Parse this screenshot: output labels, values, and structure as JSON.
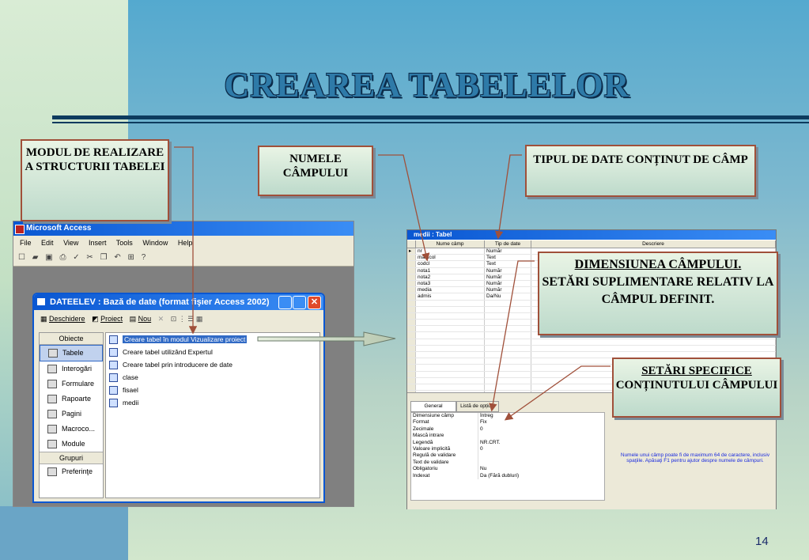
{
  "slide": {
    "title": "CREAREA TABELELOR",
    "page_number": "14"
  },
  "callouts": {
    "modul": "MODUL DE REALIZARE A STRUCTURII TABELEI",
    "numele": "NUMELE CÂMPULUI",
    "tipul": "TIPUL DE DATE CONȚINUT DE CÂMP",
    "dimensiunea_underlined": "DIMENSIUNEA CÂMPULUI.",
    "dimensiunea_rest": "SETĂRI SUPLIMENTARE RELATIV LA CÂMPUL DEFINIT.",
    "setari_underlined": "SETĂRI SPECIFICE",
    "setari_rest": "CONȚINUTULUI CÂMPULUI"
  },
  "access_window": {
    "title": "Microsoft Access",
    "menu": [
      "File",
      "Edit",
      "View",
      "Insert",
      "Tools",
      "Window",
      "Help"
    ],
    "db_window": {
      "title": "DATEELEV : Bază de date (format fişier Access 2002)",
      "toolbar": [
        "Deschidere",
        "Proiect",
        "Nou"
      ],
      "objects_header": "Obiecte",
      "objects": [
        "Tabele",
        "Interogări",
        "Formulare",
        "Rapoarte",
        "Pagini",
        "Macroco...",
        "Module"
      ],
      "groups_header": "Grupuri",
      "groups": [
        "Preferinţe"
      ],
      "items": [
        "Creare tabel în modul Vizualizare proiect",
        "Creare tabel utilizând Expertul",
        "Creare tabel prin introducere de date",
        "clase",
        "fisael",
        "medii"
      ]
    }
  },
  "table_design": {
    "title": "medii : Tabel",
    "headers": [
      "Nume câmp",
      "Tip de date",
      "Descriere"
    ],
    "rows": [
      [
        "nr",
        "Număr"
      ],
      [
        "matricol",
        "Text"
      ],
      [
        "codcl",
        "Text"
      ],
      [
        "nota1",
        "Număr"
      ],
      [
        "nota2",
        "Număr"
      ],
      [
        "nota3",
        "Număr"
      ],
      [
        "media",
        "Număr"
      ],
      [
        "admis",
        "Da/Nu"
      ]
    ],
    "tabs": [
      "General",
      "Listă de opțiuni"
    ],
    "properties": [
      [
        "Dimensiune câmp",
        "Întreg"
      ],
      [
        "Format",
        "Fix"
      ],
      [
        "Zecimale",
        "0"
      ],
      [
        "Mască intrare",
        ""
      ],
      [
        "Legendă",
        "NR.CRT."
      ],
      [
        "Valoare implicită",
        "0"
      ],
      [
        "Regulă de validare",
        ""
      ],
      [
        "Text de validare",
        ""
      ],
      [
        "Obligatoriu",
        "Nu"
      ],
      [
        "Indexat",
        "Da (Fără dubluri)"
      ]
    ],
    "help_text": "Numele unui câmp poate fi de maximum 64 de caractere, inclusiv spaţiile. Apăsaţi F1 pentru ajutor despre numele de câmpuri."
  },
  "colors": {
    "title_blue": "#2e7aa8",
    "callout_border": "#a0503a",
    "xp_blue": "#0a57d2"
  }
}
